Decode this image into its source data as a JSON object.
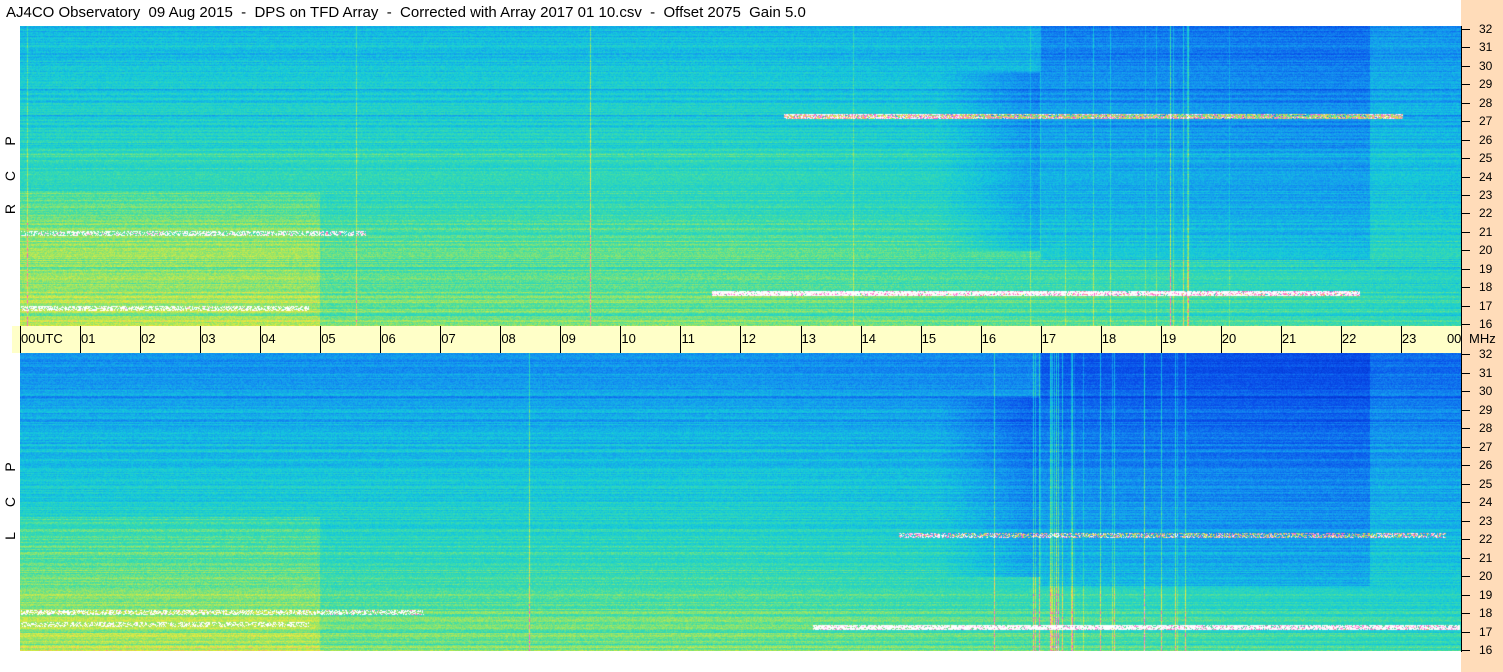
{
  "title": "AJ4CO Observatory  09 Aug 2015  -  DPS on TFD Array  -  Corrected with Array 2017 01 10.csv  -  Offset 2075  Gain 5.0",
  "panels": {
    "rcp": {
      "letters": [
        "P",
        "C",
        "R"
      ]
    },
    "lcp": {
      "letters": [
        "P",
        "C",
        "L"
      ]
    }
  },
  "time_axis": {
    "labels": [
      "00",
      "01",
      "02",
      "03",
      "04",
      "05",
      "06",
      "07",
      "08",
      "09",
      "10",
      "11",
      "12",
      "13",
      "14",
      "15",
      "16",
      "17",
      "18",
      "19",
      "20",
      "21",
      "22",
      "23",
      "00"
    ],
    "utc_label": "UTC",
    "mhz_label": "MHz"
  },
  "chart_data": {
    "type": "heatmap",
    "title": "AJ4CO Observatory  09 Aug 2015  -  DPS on TFD Array  -  Corrected with Array 2017 01 10.csv  -  Offset 2075  Gain 5.0",
    "xlabel": "UTC",
    "ylabel": "MHz",
    "x_range": [
      "00",
      "00"
    ],
    "y_range": [
      16,
      32
    ],
    "y_ticks": [
      32,
      31,
      30,
      29,
      28,
      27,
      26,
      25,
      24,
      23,
      22,
      21,
      20,
      19,
      18,
      17,
      16
    ],
    "series": [
      {
        "name": "RCP"
      },
      {
        "name": "LCP"
      }
    ]
  },
  "colors": {
    "time_band": "#ffffc8",
    "freq_axis": "#ffdcb9",
    "spectrogram_base": "#1e8cf0"
  }
}
